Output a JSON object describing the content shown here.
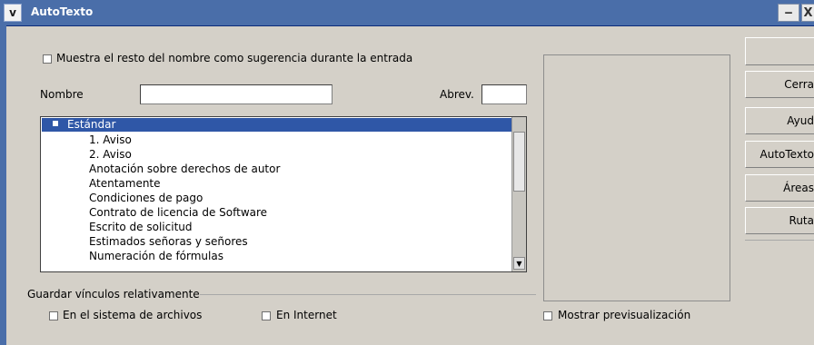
{
  "window": {
    "title": "AutoTexto",
    "sys_glyph": "v",
    "min_glyph": "‒",
    "close_glyph": "X"
  },
  "options": {
    "suggest_label": "Muestra el resto del nombre como sugerencia durante la entrada"
  },
  "form": {
    "nombre_label": "Nombre",
    "abrev_label": "Abrev."
  },
  "list": {
    "header": "Estándar",
    "items": [
      "1. Aviso",
      "2. Aviso",
      "Anotación sobre derechos de autor",
      "Atentamente",
      "Condiciones de pago",
      "Contrato de licencia de Software",
      "Escrito de solicitud",
      "Estimados señoras y señores",
      "Numeración de fórmulas"
    ]
  },
  "save_links": {
    "label": "Guardar vínculos relativamente",
    "filesystem_label": "En el sistema de archivos",
    "internet_label": "En Internet"
  },
  "preview": {
    "show_label": "Mostrar previsualización"
  },
  "buttons": {
    "close": "Cerra",
    "help": "Ayud",
    "autotext": "AutoTexto",
    "areas": "Áreas",
    "paths": "Ruta"
  }
}
